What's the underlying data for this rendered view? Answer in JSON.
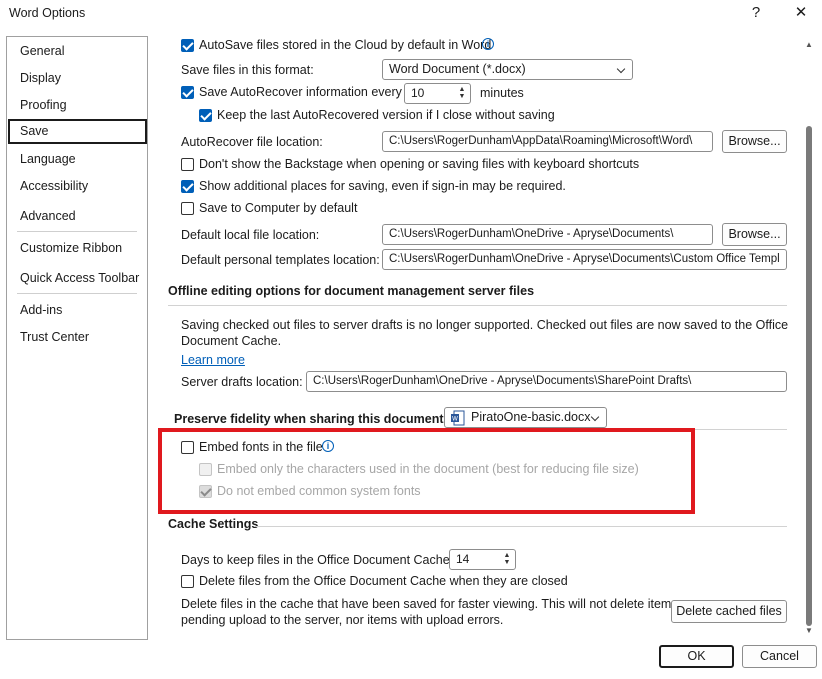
{
  "window": {
    "title": "Word Options",
    "help_label": "?",
    "close_label": "✕"
  },
  "sidebar": {
    "items": [
      {
        "label": "General"
      },
      {
        "label": "Display"
      },
      {
        "label": "Proofing"
      },
      {
        "label": "Save",
        "selected": true
      },
      {
        "label": "Language"
      },
      {
        "label": "Accessibility"
      },
      {
        "label": "Advanced"
      },
      {
        "label": "Customize Ribbon"
      },
      {
        "label": "Quick Access Toolbar"
      },
      {
        "label": "Add-ins"
      },
      {
        "label": "Trust Center"
      }
    ]
  },
  "save_docs": {
    "autosave_label": "AutoSave files stored in the Cloud by default in Word",
    "autosave_checked": true,
    "format_label": "Save files in this format:",
    "format_value": "Word Document (*.docx)",
    "autorecover_label": "Save AutoRecover information every",
    "autorecover_checked": true,
    "autorecover_minutes": "10",
    "minutes_label": "minutes",
    "keep_last_label": "Keep the last AutoRecovered version if I close without saving",
    "keep_last_checked": true,
    "ar_location_label": "AutoRecover file location:",
    "ar_location_value": "C:\\Users\\RogerDunham\\AppData\\Roaming\\Microsoft\\Word\\",
    "browse_label": "Browse...",
    "backstage_label": "Don't show the Backstage when opening or saving files with keyboard shortcuts",
    "backstage_checked": false,
    "additional_places_label": "Show additional places for saving, even if sign-in may be required.",
    "additional_places_checked": true,
    "save_computer_label": "Save to Computer by default",
    "save_computer_checked": false,
    "local_location_label": "Default local file location:",
    "local_location_value": "C:\\Users\\RogerDunham\\OneDrive - Apryse\\Documents\\",
    "browse2_label": "Browse...",
    "templates_label": "Default personal templates location:",
    "templates_value": "C:\\Users\\RogerDunham\\OneDrive - Apryse\\Documents\\Custom Office Templ"
  },
  "offline": {
    "heading": "Offline editing options for document management server files",
    "desc_line1": "Saving checked out files to server drafts is no longer supported. Checked out files are now saved to the Office",
    "desc_line2": "Document Cache.",
    "learn_more": "Learn more",
    "drafts_label": "Server drafts location:",
    "drafts_value": "C:\\Users\\RogerDunham\\OneDrive - Apryse\\Documents\\SharePoint Drafts\\"
  },
  "fidelity": {
    "heading": "Preserve fidelity when sharing this document:",
    "document_value": "PiratoOne-basic.docx",
    "embed_label": "Embed fonts in the file",
    "embed_checked": false,
    "embed_only_label": "Embed only the characters used in the document (best for reducing file size)",
    "embed_only_checked": false,
    "no_common_label": "Do not embed common system fonts",
    "no_common_checked": true
  },
  "cache": {
    "heading": "Cache Settings",
    "days_label": "Days to keep files in the Office Document Cache:",
    "days_value": "14",
    "delete_closed_label": "Delete files from the Office Document Cache when they are closed",
    "delete_closed_checked": false,
    "delete_desc_line1": "Delete files in the cache that have been saved for faster viewing. This will not delete items",
    "delete_desc_line2": "pending upload to the server, nor items with upload errors.",
    "delete_cached_label": "Delete cached files"
  },
  "footer": {
    "ok_label": "OK",
    "cancel_label": "Cancel"
  },
  "colors": {
    "accent": "#005fb8",
    "highlight_box": "#e0191e"
  }
}
